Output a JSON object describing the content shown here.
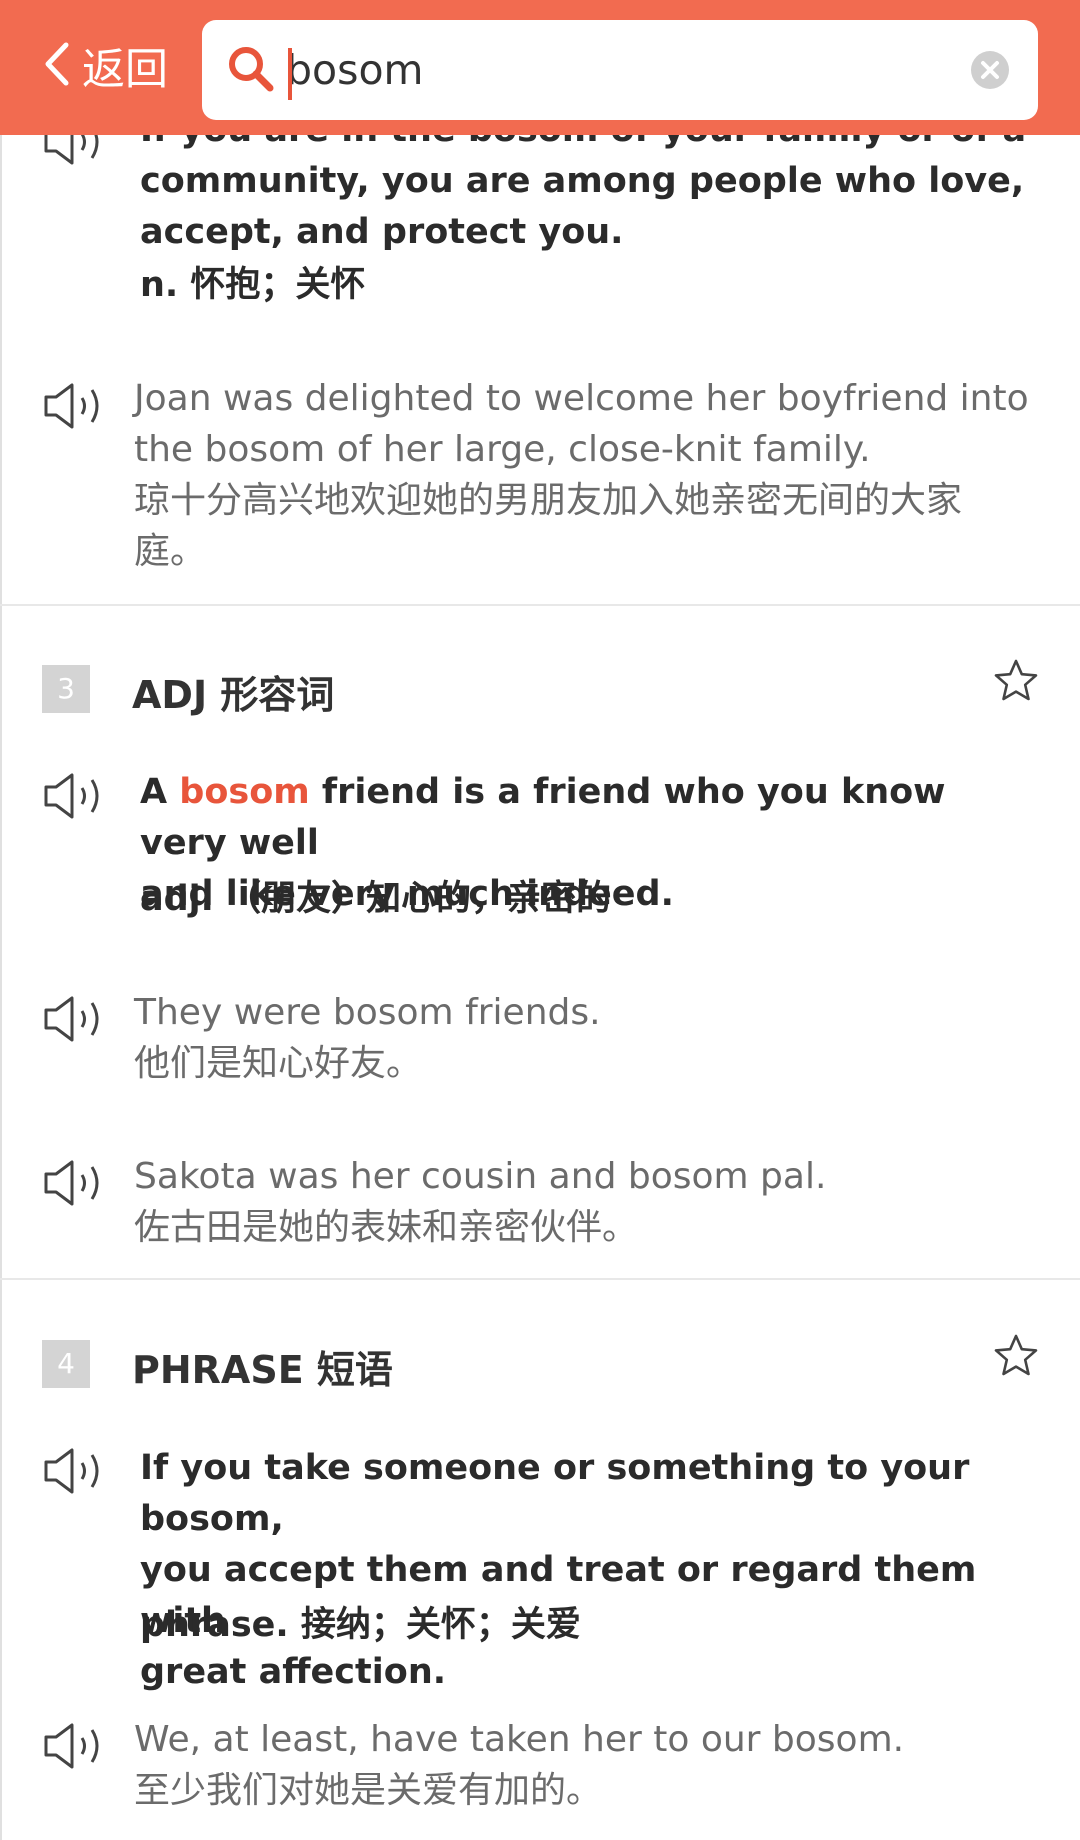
{
  "header": {
    "back_label": "返回",
    "search_value": "bosom"
  },
  "sections": [
    {
      "definition_lines": [
        "If you are in the bosom of your family or of a",
        "community, you are among people who love,",
        "accept, and protect you."
      ],
      "definition_cn": "n. 怀抱；关怀",
      "examples": [
        {
          "en_lines": [
            "Joan was delighted to welcome her boyfriend into",
            "the bosom of her large, close-knit family."
          ],
          "cn_lines": [
            "琼十分高兴地欢迎她的男朋友加入她亲密无间的大家",
            "庭。"
          ]
        }
      ]
    },
    {
      "number": "3",
      "pos_label": "ADJ 形容词",
      "definition_prefix": "A ",
      "definition_highlight": "bosom",
      "definition_line1_rest": " friend is a friend who you know very well",
      "definition_line2": "and like very much indeed.",
      "definition_cn": "adj. （朋友）知心的，亲密的",
      "examples": [
        {
          "en": "They were bosom friends.",
          "cn": "他们是知心好友。"
        },
        {
          "en": "Sakota was her cousin and bosom pal.",
          "cn": "佐古田是她的表妹和亲密伙伴。"
        }
      ]
    },
    {
      "number": "4",
      "pos_label": "PHRASE 短语",
      "definition_lines": [
        "If you take someone or something to your bosom,",
        "you accept them and treat or regard them with",
        "great affection."
      ],
      "definition_cn": "phrase. 接纳；关怀；关爱",
      "examples": [
        {
          "en": "We, at least, have taken her to our bosom.",
          "cn": "至少我们对她是关爱有加的。"
        }
      ]
    }
  ],
  "colors": {
    "accent": "#f26b50",
    "highlight": "#e8553b"
  },
  "icons": [
    "chevron-left-icon",
    "search-icon",
    "clear-icon",
    "speaker-icon",
    "star-icon"
  ]
}
